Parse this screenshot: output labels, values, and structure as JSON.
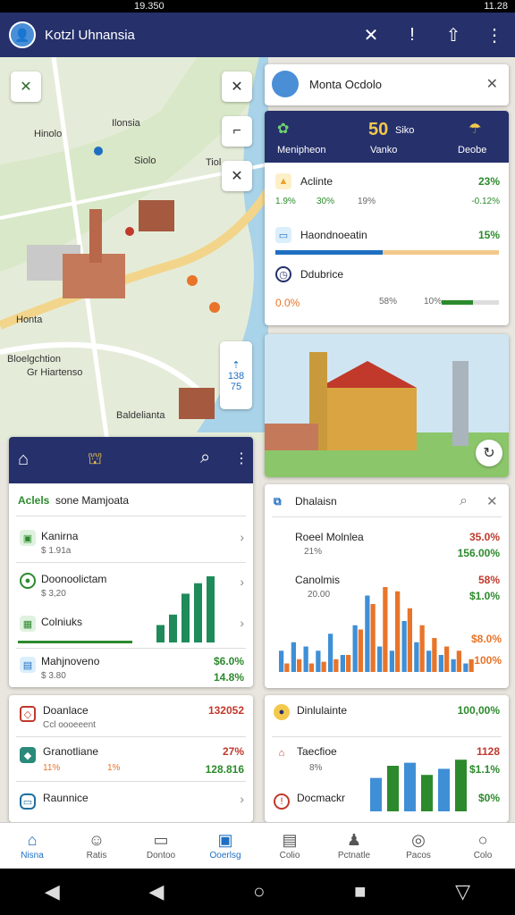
{
  "status": {
    "center": "19.350",
    "right": "11.28"
  },
  "appbar": {
    "title": "Kotzl Uhnansia",
    "close": "✕",
    "info": "!",
    "share": "⇧",
    "more": "⋮"
  },
  "map_labels": [
    "Hinolo",
    "Ilonsia",
    "Siolo",
    "Tiol",
    "Honta",
    "Bloelgchtion",
    "Gr Hiartenso",
    "Baldelianta"
  ],
  "map_buttons": {
    "tools": "✕",
    "close": "✕",
    "layers": "⌐",
    "compass": "✕",
    "zoom": "⇡",
    "side": "↻"
  },
  "zoom_box": {
    "top": "138",
    "bottom": "75"
  },
  "info_card": {
    "title": "Monta Ocdolo",
    "close": "✕"
  },
  "stats_card": {
    "col1": "Menipheon",
    "col2_value": "50",
    "col2_unit": "Siko",
    "col2": "Vanko",
    "col3": "Deobe",
    "row1_label": "Aclinte",
    "row1_value": "23%",
    "row1_a": "1.9%",
    "row1_b": "30%",
    "row1_c": "19%",
    "row1_d": "-0.12%",
    "row2_label": "Haondnoeatin",
    "row2_value": "15%",
    "row2_bar": 0.48,
    "row3_label": "Ddubrice",
    "row3_a": "0.0%",
    "row3_b": "58%",
    "row3_c": "10%",
    "row3_bar": 0.55
  },
  "list_card": {
    "title_prefix": "Aclels",
    "title": "sone Mamjoata",
    "items": [
      {
        "label": "Kanirna",
        "sub": "$ 1.91a"
      },
      {
        "label": "Doonoolictam",
        "sub": "$ 3,20"
      },
      {
        "label": "Colniuks",
        "sub": ""
      },
      {
        "label": "Mahjnoveno",
        "sub": "$ 3.80",
        "v1": "$6.0%",
        "v2": "14.8%"
      }
    ],
    "bars": [
      0.25,
      0.4,
      0.7,
      0.85,
      0.95
    ]
  },
  "chart_card": {
    "title": "Dhalaisn",
    "row1_label": "Roeel Molnlea",
    "row1_v1": "35.0%",
    "row1_v2": "156.00%",
    "row1_sub": "21%",
    "row2_label": "Canolmis",
    "row2_v": "58%",
    "row2_v2": "$1.0%",
    "row2_sub": "20.00",
    "row3_v1": "$8.0%",
    "row3_v2": "100%"
  },
  "chart_data": {
    "type": "bar",
    "series": [
      {
        "color": "#3f8fd6",
        "values": [
          0.25,
          0.35,
          0.3,
          0.25,
          0.45,
          0.2,
          0.55,
          0.9,
          0.3,
          0.25,
          0.6,
          0.35,
          0.25,
          0.2,
          0.15,
          0.1
        ]
      },
      {
        "color": "#e8742a",
        "values": [
          0.1,
          0.15,
          0.1,
          0.12,
          0.15,
          0.2,
          0.5,
          0.8,
          1.0,
          0.95,
          0.75,
          0.55,
          0.4,
          0.3,
          0.25,
          0.15
        ]
      }
    ]
  },
  "bottom_left_card": {
    "r1_label": "Doanlace",
    "r1_sub": "Ccl oooeeent",
    "r1_value": "132052",
    "r2_label": "Granotliane",
    "r2_a": "11%",
    "r2_b": "1%",
    "r2_value": "27%",
    "r2_value2": "128.816",
    "r3_label": "Raunnice"
  },
  "bottom_right_card": {
    "r1_label": "Dinlulainte",
    "r1_value": "100,00%",
    "r2_label": "Taecfioe",
    "r2_sub": "8%",
    "r2_value": "1128",
    "r2_value2": "$1.1%",
    "r3_label": "Docmackr",
    "r3_value": "$0%",
    "bars": [
      0.55,
      0.75,
      0.8,
      0.6,
      0.7,
      0.85
    ]
  },
  "nav": [
    "Nisna",
    "Ratis",
    "Dontoo",
    "Ooerlsg",
    "Colio",
    "Pctnatle",
    "Pacos",
    "Colo"
  ],
  "colors": {
    "accent": "#26306b",
    "green": "#2c8a2c",
    "blue": "#1e6fc2",
    "orange": "#e8742a"
  }
}
